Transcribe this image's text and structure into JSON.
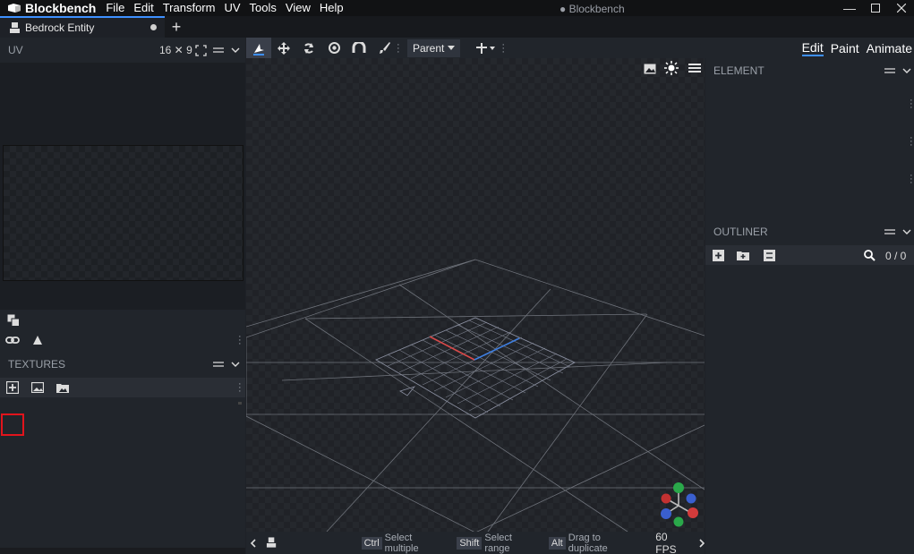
{
  "menubar": {
    "app_name": "Blockbench",
    "items": [
      "File",
      "Edit",
      "Transform",
      "UV",
      "Tools",
      "View",
      "Help"
    ],
    "window_title": "● Blockbench"
  },
  "tabs": {
    "project_tab": "Bedrock Entity"
  },
  "uv_panel": {
    "title": "UV",
    "size": "16 ✕ 9"
  },
  "textures_panel": {
    "title": "TEXTURES"
  },
  "toolbar": {
    "pivot_mode": "Parent"
  },
  "modes": [
    "Edit",
    "Paint",
    "Animate"
  ],
  "element_panel": {
    "title": "ELEMENT"
  },
  "outliner_panel": {
    "title": "OUTLINER",
    "count": "0 / 0"
  },
  "statusbar": {
    "ctrl_key": "Ctrl",
    "ctrl_text": "Select multiple",
    "shift_key": "Shift",
    "shift_text": "Select range",
    "alt_key": "Alt",
    "alt_text": "Drag to duplicate",
    "fps": "60 FPS"
  },
  "colors": {
    "accent": "#3e90ff",
    "highlight": "#e2141c"
  }
}
